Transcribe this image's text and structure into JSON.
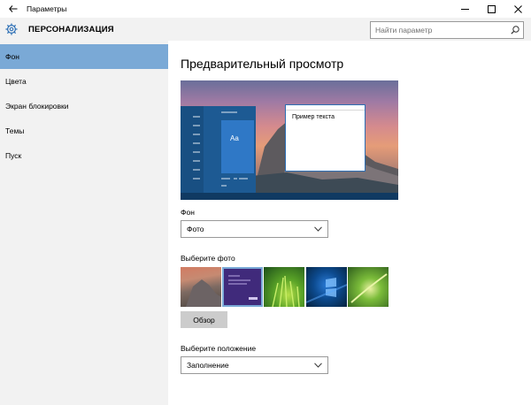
{
  "window": {
    "title": "Параметры"
  },
  "header": {
    "title": "ПЕРСОНАЛИЗАЦИЯ",
    "search_placeholder": "Найти параметр"
  },
  "sidebar": {
    "items": [
      {
        "label": "Фон",
        "active": true
      },
      {
        "label": "Цвета",
        "active": false
      },
      {
        "label": "Экран блокировки",
        "active": false
      },
      {
        "label": "Темы",
        "active": false
      },
      {
        "label": "Пуск",
        "active": false
      }
    ]
  },
  "main": {
    "preview_title": "Предварительный просмотр",
    "preview": {
      "tile_text": "Aa",
      "sample_text": "Пример текста"
    },
    "background_label": "Фон",
    "background_value": "Фото",
    "choose_photo_label": "Выберите фото",
    "photos": [
      "mountain-photo",
      "purple-photo",
      "grass-photo",
      "windows-light-photo",
      "green-sprout-photo"
    ],
    "browse_label": "Обзор",
    "position_label": "Выберите положение",
    "position_value": "Заполнение"
  },
  "colors": {
    "accent": "#7aa9d6",
    "sidebar_bg": "#f2f2f2",
    "button_bg": "#cccccc"
  }
}
